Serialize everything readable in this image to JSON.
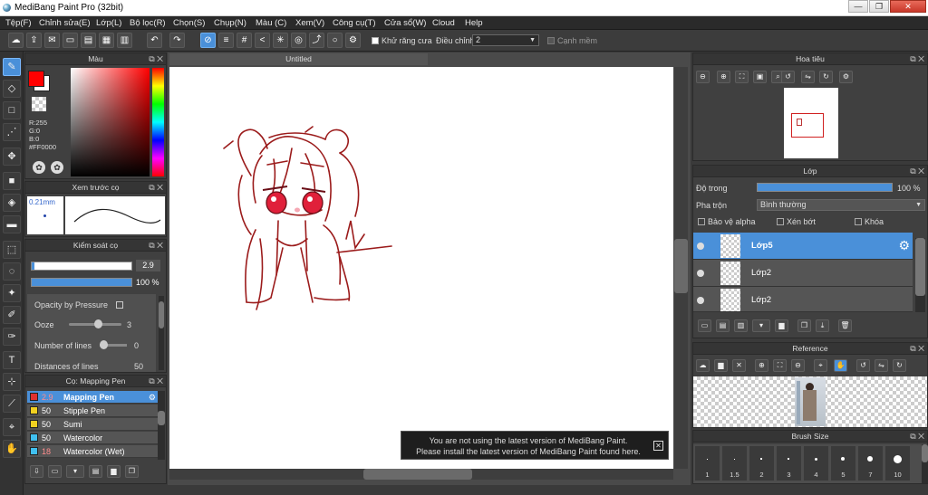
{
  "window": {
    "title": "MediBang Paint Pro (32bit)",
    "minimize": "—",
    "restore": "❐",
    "close": "✕"
  },
  "menu": [
    "Tệp(F)",
    "Chỉnh sửa(E)",
    "Lớp(L)",
    "Bộ lọc(R)",
    "Chọn(S)",
    "Chụp(N)",
    "Màu (C)",
    "Xem(V)",
    "Công cụ(T)",
    "Cửa sổ(W)",
    "Cloud",
    "Help"
  ],
  "toolbar": {
    "antialias_label": "Khử răng cưa",
    "correction_label": "Điều chỉnh",
    "correction_value": "2",
    "soft_edge_label": "Cạnh mềm"
  },
  "color_panel": {
    "title": "Màu",
    "r": "R:255",
    "g": "G:0",
    "b": "B:0",
    "hex": "#FF0000",
    "primary": "#ff0000",
    "secondary": "#ffffff"
  },
  "brush_preview": {
    "title": "Xem trước cọ",
    "size": "0.21mm"
  },
  "brush_control": {
    "title": "Kiểm soát cọ",
    "size_value": "2.9",
    "opacity_value": "100 %",
    "opacity_pressure_label": "Opacity by Pressure",
    "ooze_label": "Ooze",
    "ooze_value": "3",
    "lines_label": "Number of lines",
    "lines_value": "0",
    "distance_label": "Distances of lines",
    "distance_value": "50"
  },
  "brush_list": {
    "title": "Cọ: Mapping Pen",
    "items": [
      {
        "size": "2.9",
        "name": "Mapping Pen",
        "color": "#e03030",
        "selected": true
      },
      {
        "size": "50",
        "name": "Stipple Pen",
        "color": "#f0d020",
        "selected": false
      },
      {
        "size": "50",
        "name": "Sumi",
        "color": "#f0d020",
        "selected": false
      },
      {
        "size": "50",
        "name": "Watercolor",
        "color": "#40c0f0",
        "selected": false
      },
      {
        "size": "18",
        "name": "Watercolor (Wet)",
        "color": "#40c0f0",
        "selected": false
      }
    ]
  },
  "canvas": {
    "tab": "Untitled"
  },
  "notice": {
    "line1": "You are not using the latest version of MediBang Paint.",
    "line2": "Please install the latest version of MediBang Paint found here.",
    "close": "✕"
  },
  "navigator": {
    "title": "Hoa tiêu"
  },
  "layer_panel": {
    "title": "Lớp",
    "opacity_label": "Độ trong",
    "opacity_value": "100 %",
    "blend_label": "Pha trộn",
    "blend_value": "Bình thường",
    "protect_alpha": "Bảo vệ alpha",
    "clipping": "Xén bớt",
    "lock": "Khóa",
    "layers": [
      {
        "name": "Lớp5",
        "selected": true
      },
      {
        "name": "Lớp2",
        "selected": false
      },
      {
        "name": "Lớp2",
        "selected": false
      }
    ]
  },
  "reference": {
    "title": "Reference"
  },
  "brush_size": {
    "title": "Brush Size",
    "sizes": [
      "1",
      "1.5",
      "2",
      "3",
      "4",
      "5",
      "7",
      "10"
    ]
  }
}
